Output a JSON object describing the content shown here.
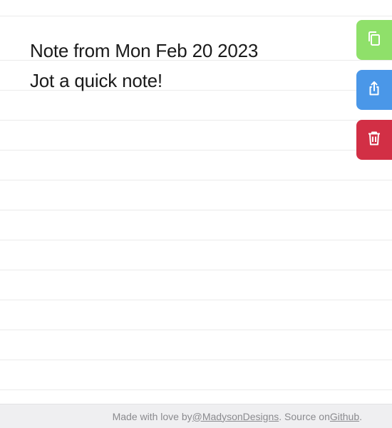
{
  "note": {
    "lines": [
      "Note from Mon Feb 20 2023",
      "Jot a quick note!"
    ]
  },
  "actions": {
    "copy": {
      "icon": "copy-icon",
      "color": "#8fe06a"
    },
    "share": {
      "icon": "share-icon",
      "color": "#4a97e8"
    },
    "delete": {
      "icon": "trash-icon",
      "color": "#d22f45"
    }
  },
  "footer": {
    "prefix": "Made with love by ",
    "author_link": "@MadysonDesigns",
    "middle": ". Source on ",
    "source_link": "Github",
    "suffix": "."
  }
}
